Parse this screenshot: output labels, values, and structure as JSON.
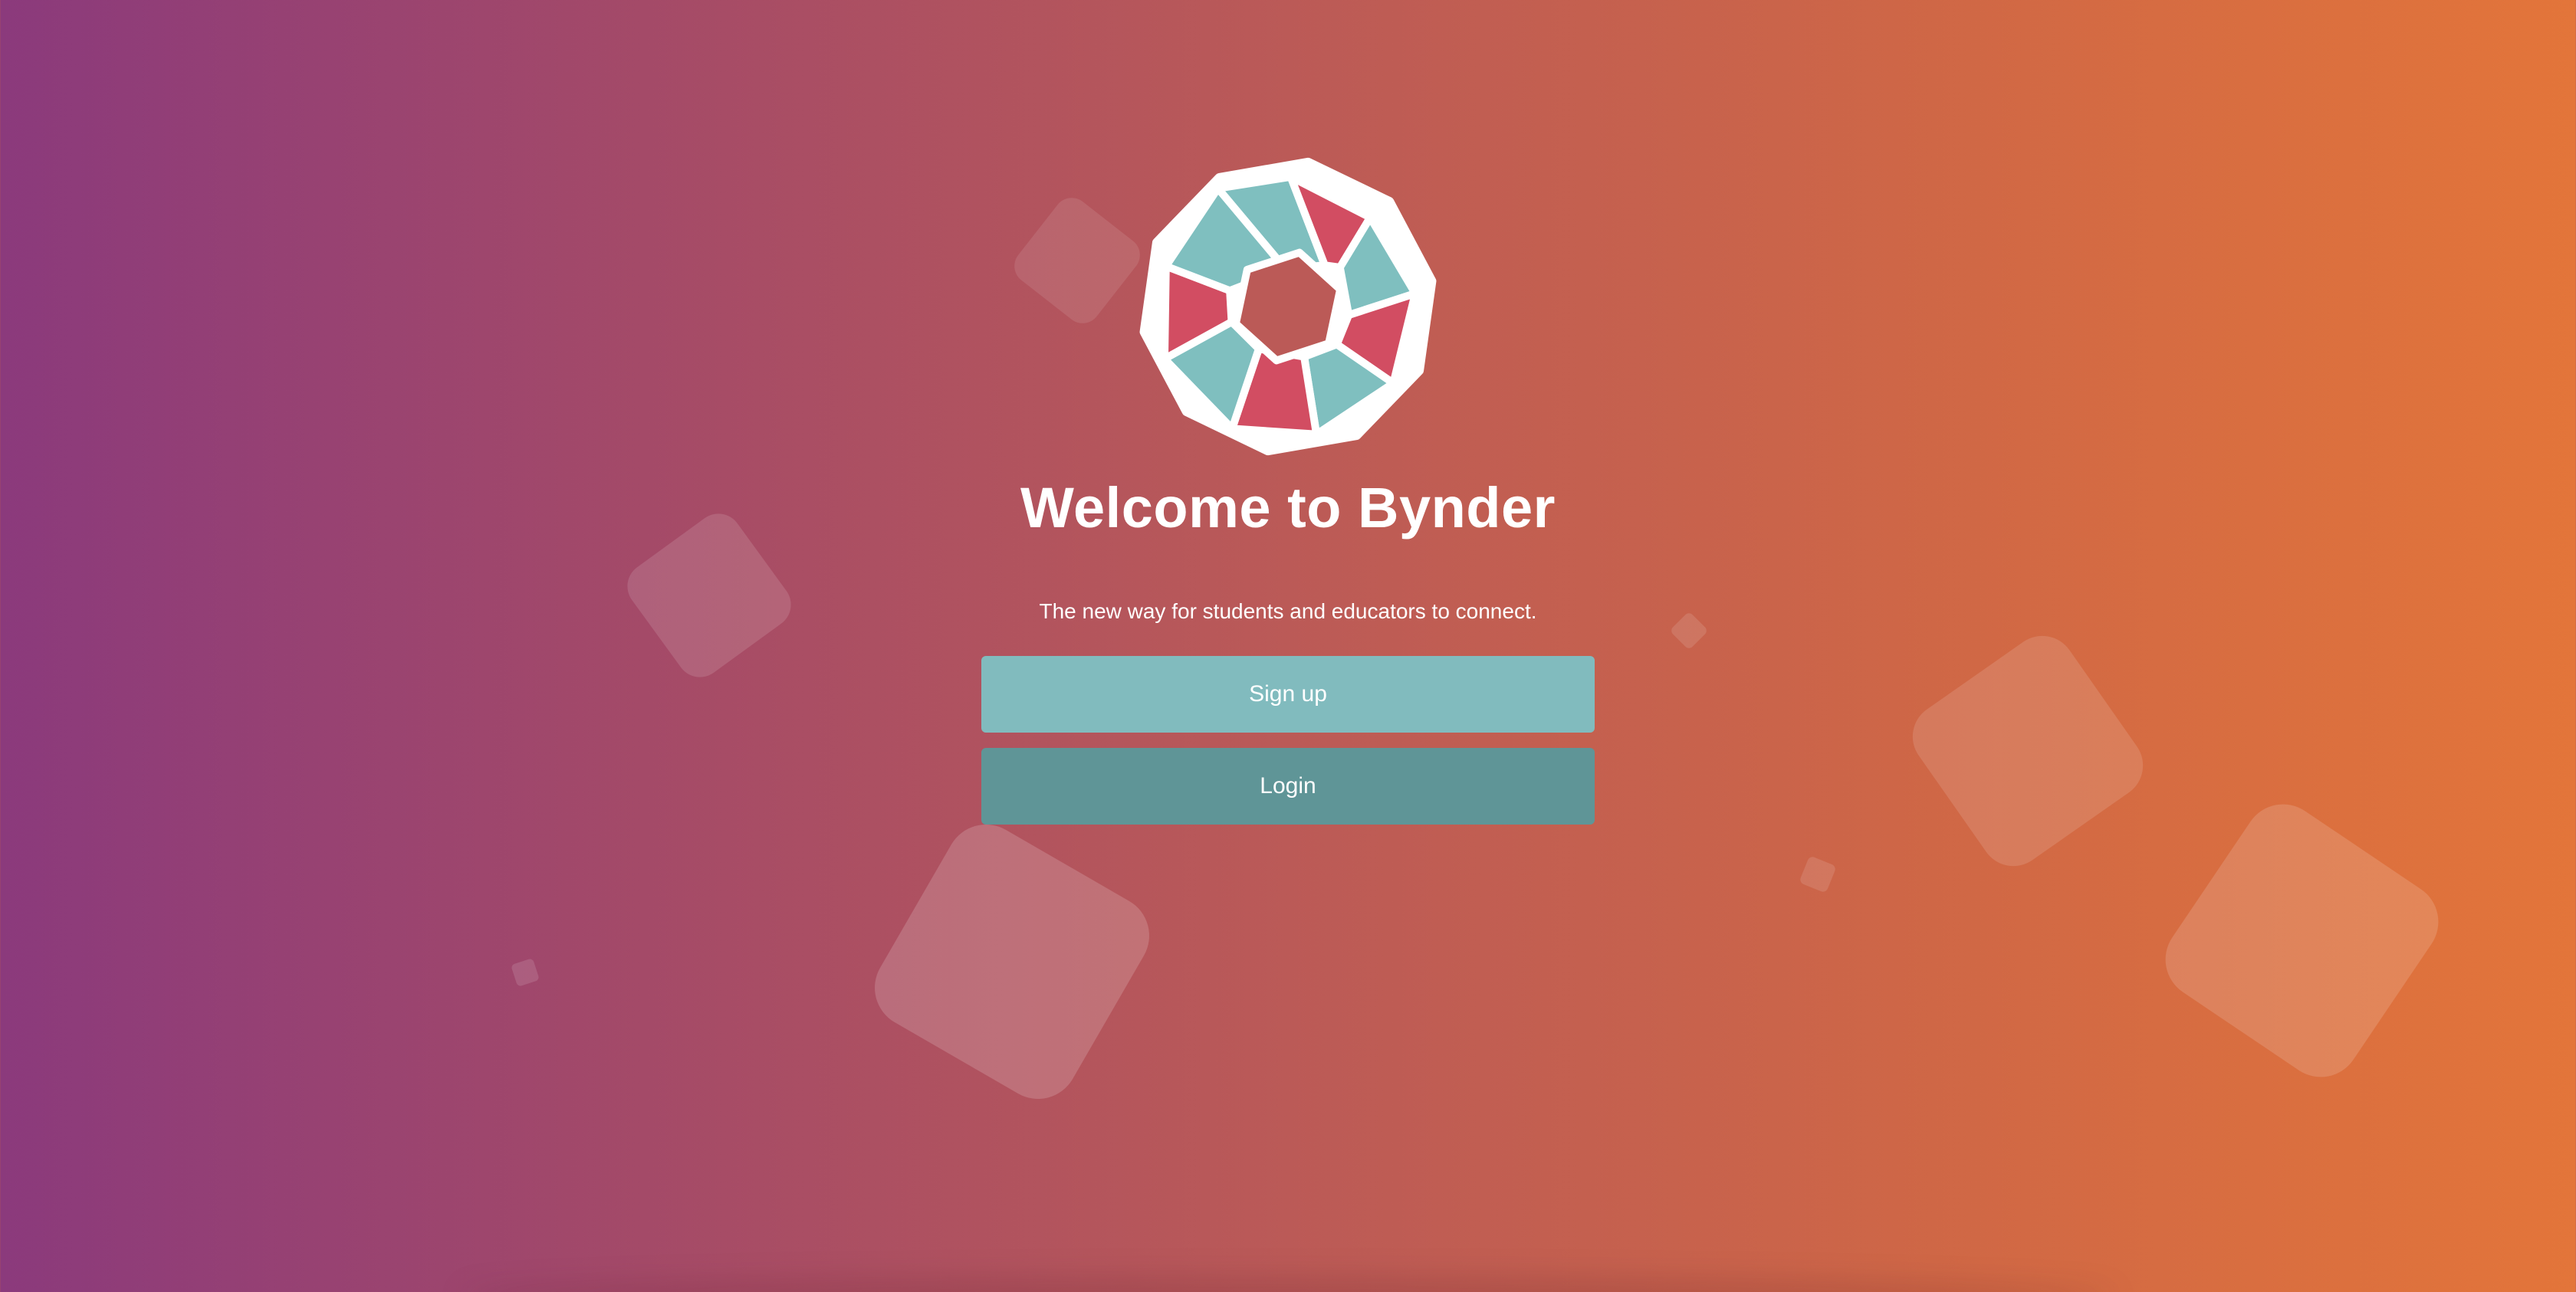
{
  "hero": {
    "title": "Welcome to Bynder",
    "subtitle": "The new way for students and educators to connect."
  },
  "actions": {
    "signup_label": "Sign up",
    "login_label": "Login"
  },
  "icons": {
    "logo": "bynder-logo-icon"
  },
  "colors": {
    "gradient_start": "#8b3a7c",
    "gradient_end": "#e3753a",
    "logo_teal": "#7fbfbf",
    "logo_red": "#d24d62",
    "signup_button": "#81bbbe",
    "login_button": "#5f9597"
  }
}
